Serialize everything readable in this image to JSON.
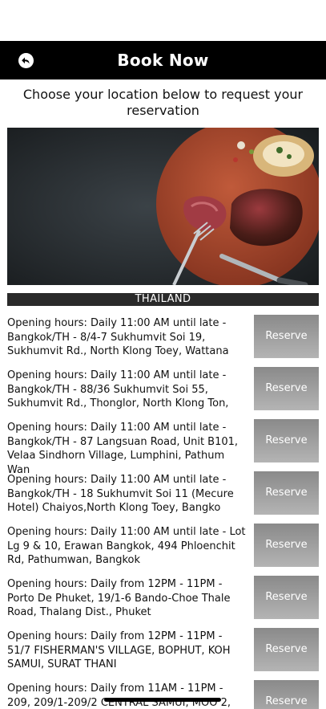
{
  "header": {
    "title": "Book Now",
    "back_icon": "back-arrow-icon"
  },
  "intro": "Choose your location below to request your reservation",
  "hero": {
    "image": "steak-on-wooden-board-photo"
  },
  "country": "THAILAND",
  "locations": [
    {
      "text": "Opening hours: Daily 11:00 AM until late - Bangkok/TH - 8/4-7 Sukhumvit Soi 19, Sukhumvit Rd., North Klong Toey, Wattana",
      "button": "Reserve"
    },
    {
      "text": "Opening hours: Daily 11:00 AM until late - Bangkok/TH - 88/36 Sukhumvit Soi 55, Sukhumvit Rd., Thonglor, North Klong Ton,",
      "button": "Reserve"
    },
    {
      "text": "Opening hours: Daily 11:00 AM until late - Bangkok/TH - 87 Langsuan Road, Unit B101, Velaa Sindhorn Village, Lumphini, Pathum Wan",
      "button": "Reserve"
    },
    {
      "text": "Opening hours: Daily 11:00 AM until late - Bangkok/TH - 18 Sukhumvit Soi 11 (Mecure Hotel) Chaiyos,North Klong Toey, Bangko",
      "button": "Reserve"
    },
    {
      "text": "Opening hours: Daily 11:00 AM until late - Lot Lg 9 & 10, Erawan Bangkok, 494 Phloenchit Rd, Pathumwan, Bangkok",
      "button": "Reserve"
    },
    {
      "text": "Opening hours: Daily from 12PM - 11PM - Porto De Phuket, 19/1-6 Bando-Choe Thale Road, Thalang Dist., Phuket",
      "button": "Reserve"
    },
    {
      "text": "Opening hours: Daily from 12PM - 11PM - 51/7 FISHERMAN'S VILLAGE, BOPHUT, KOH SAMUI, SURAT THANI",
      "button": "Reserve"
    },
    {
      "text": "Opening hours: Daily from 11AM - 11PM - 209, 209/1-209/2 CENTRAL SAMUI, MOO 2,",
      "button": "Reserve"
    }
  ]
}
